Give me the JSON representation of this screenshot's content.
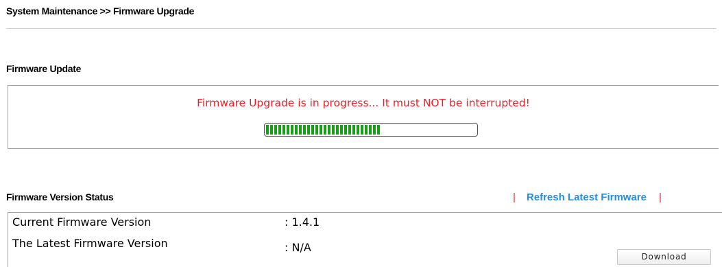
{
  "breadcrumb": "System Maintenance >> Firmware Upgrade",
  "firmware_update": {
    "title": "Firmware Update",
    "message": "Firmware Upgrade is in progress... It must NOT be interrupted!",
    "progress_percent": 55
  },
  "version_status": {
    "title": "Firmware Version Status",
    "separator": "|",
    "refresh_label": "Refresh Latest Firmware",
    "rows": [
      {
        "label": "Current Firmware Version",
        "value": ": 1.4.1"
      },
      {
        "label": "The Latest Firmware Version",
        "value": ": N/A"
      }
    ],
    "download_label": "Download"
  },
  "colors": {
    "warning": "#e8202a",
    "link": "#1f8fe0",
    "progress": "#16a016"
  }
}
